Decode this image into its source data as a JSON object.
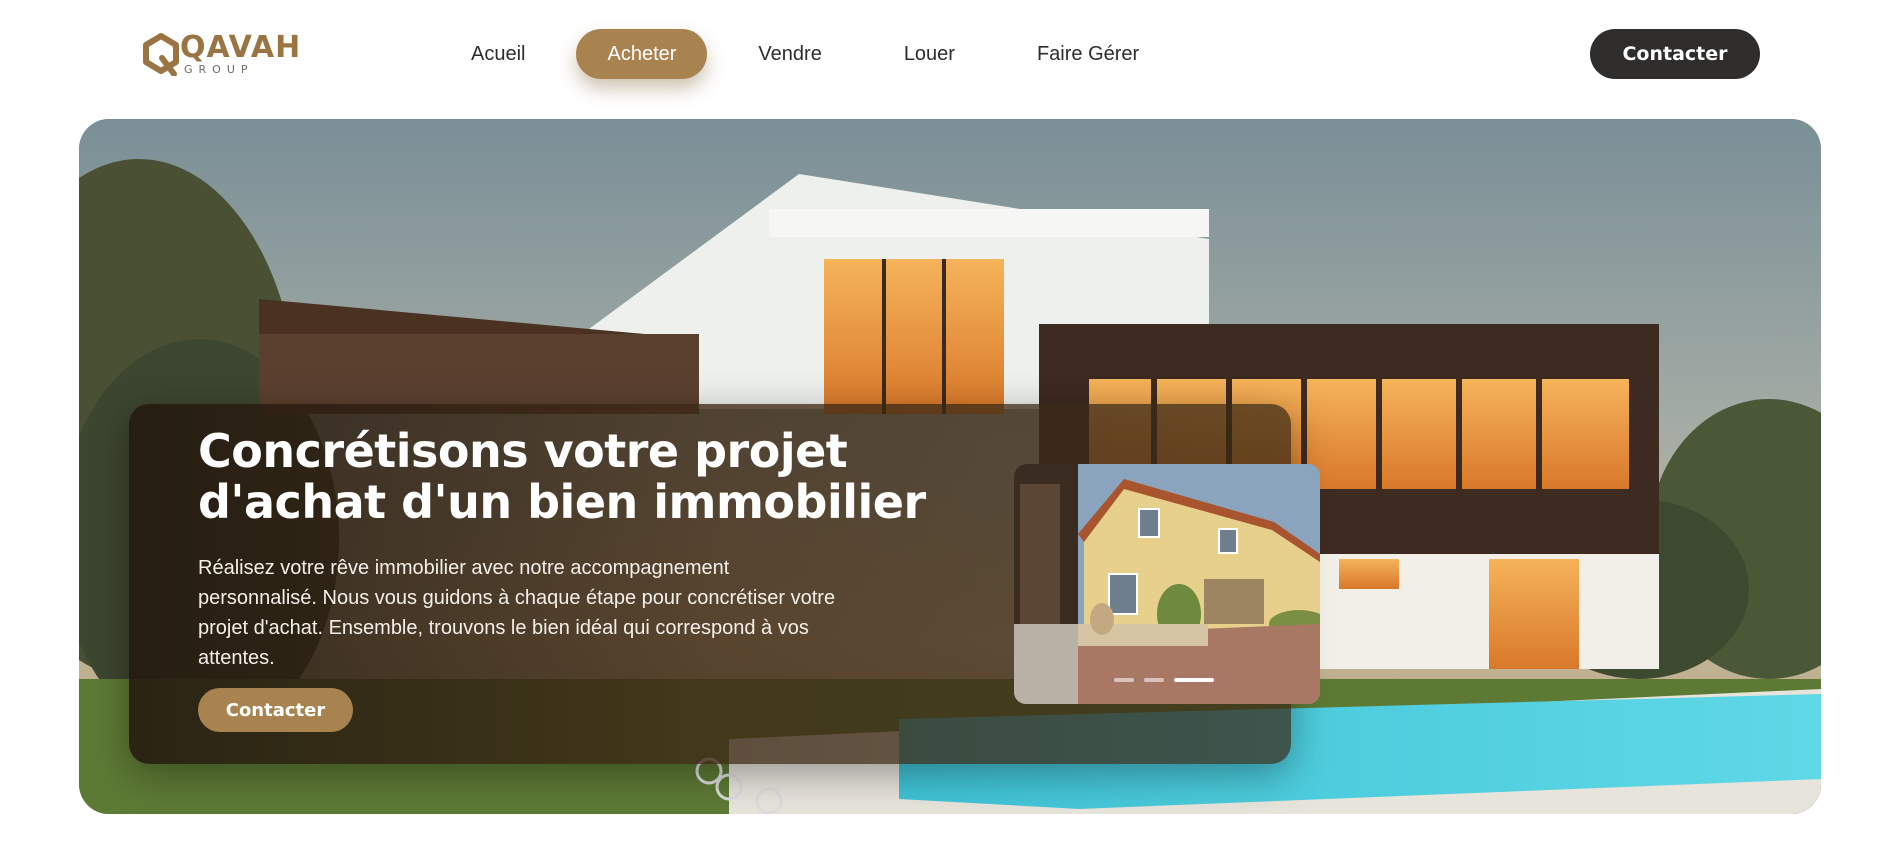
{
  "brand": {
    "name": "QAVAH",
    "subtitle": "GROUP",
    "color": "#9b7443"
  },
  "nav": {
    "items": [
      {
        "label": "Acueil",
        "active": false
      },
      {
        "label": "Acheter",
        "active": true
      },
      {
        "label": "Vendre",
        "active": false
      },
      {
        "label": "Louer",
        "active": false
      },
      {
        "label": "Faire Gérer",
        "active": false
      }
    ],
    "accent_color": "#a8834f"
  },
  "header": {
    "cta_label": "Contacter"
  },
  "hero": {
    "title": "Concrétisons votre projet d'achat d'un bien immobilier",
    "description": "Réalisez votre rêve immobilier avec notre accompagnement personnalisé. Nous vous guidons à chaque étape pour concrétiser votre projet d'achat. Ensemble, trouvons le bien idéal qui correspond à vos attentes.",
    "cta_label": "Contacter",
    "carousel": {
      "slide_count": 3,
      "active_index": 2
    }
  }
}
